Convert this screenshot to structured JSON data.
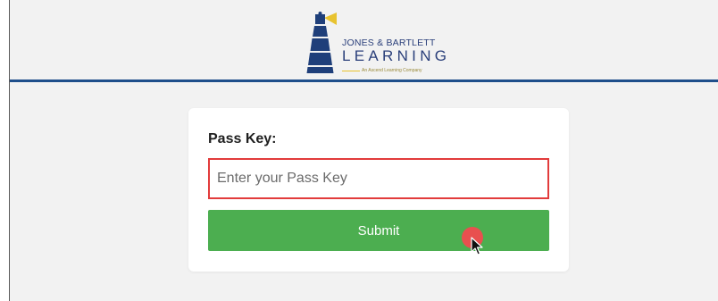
{
  "brand": {
    "line1": "JONES & BARTLETT",
    "line2": "LEARNING",
    "tagline": "An Ascend Learning Company",
    "icon": "lighthouse-icon",
    "colors": {
      "navy": "#1f3f7a",
      "yellow": "#e8c330",
      "header_rule": "#1f4f8b"
    }
  },
  "form": {
    "label": "Pass Key:",
    "input": {
      "value": "",
      "placeholder": "Enter your Pass Key"
    },
    "submit_label": "Submit",
    "colors": {
      "submit": "#4cae50",
      "input_border": "#e23b3b"
    }
  }
}
